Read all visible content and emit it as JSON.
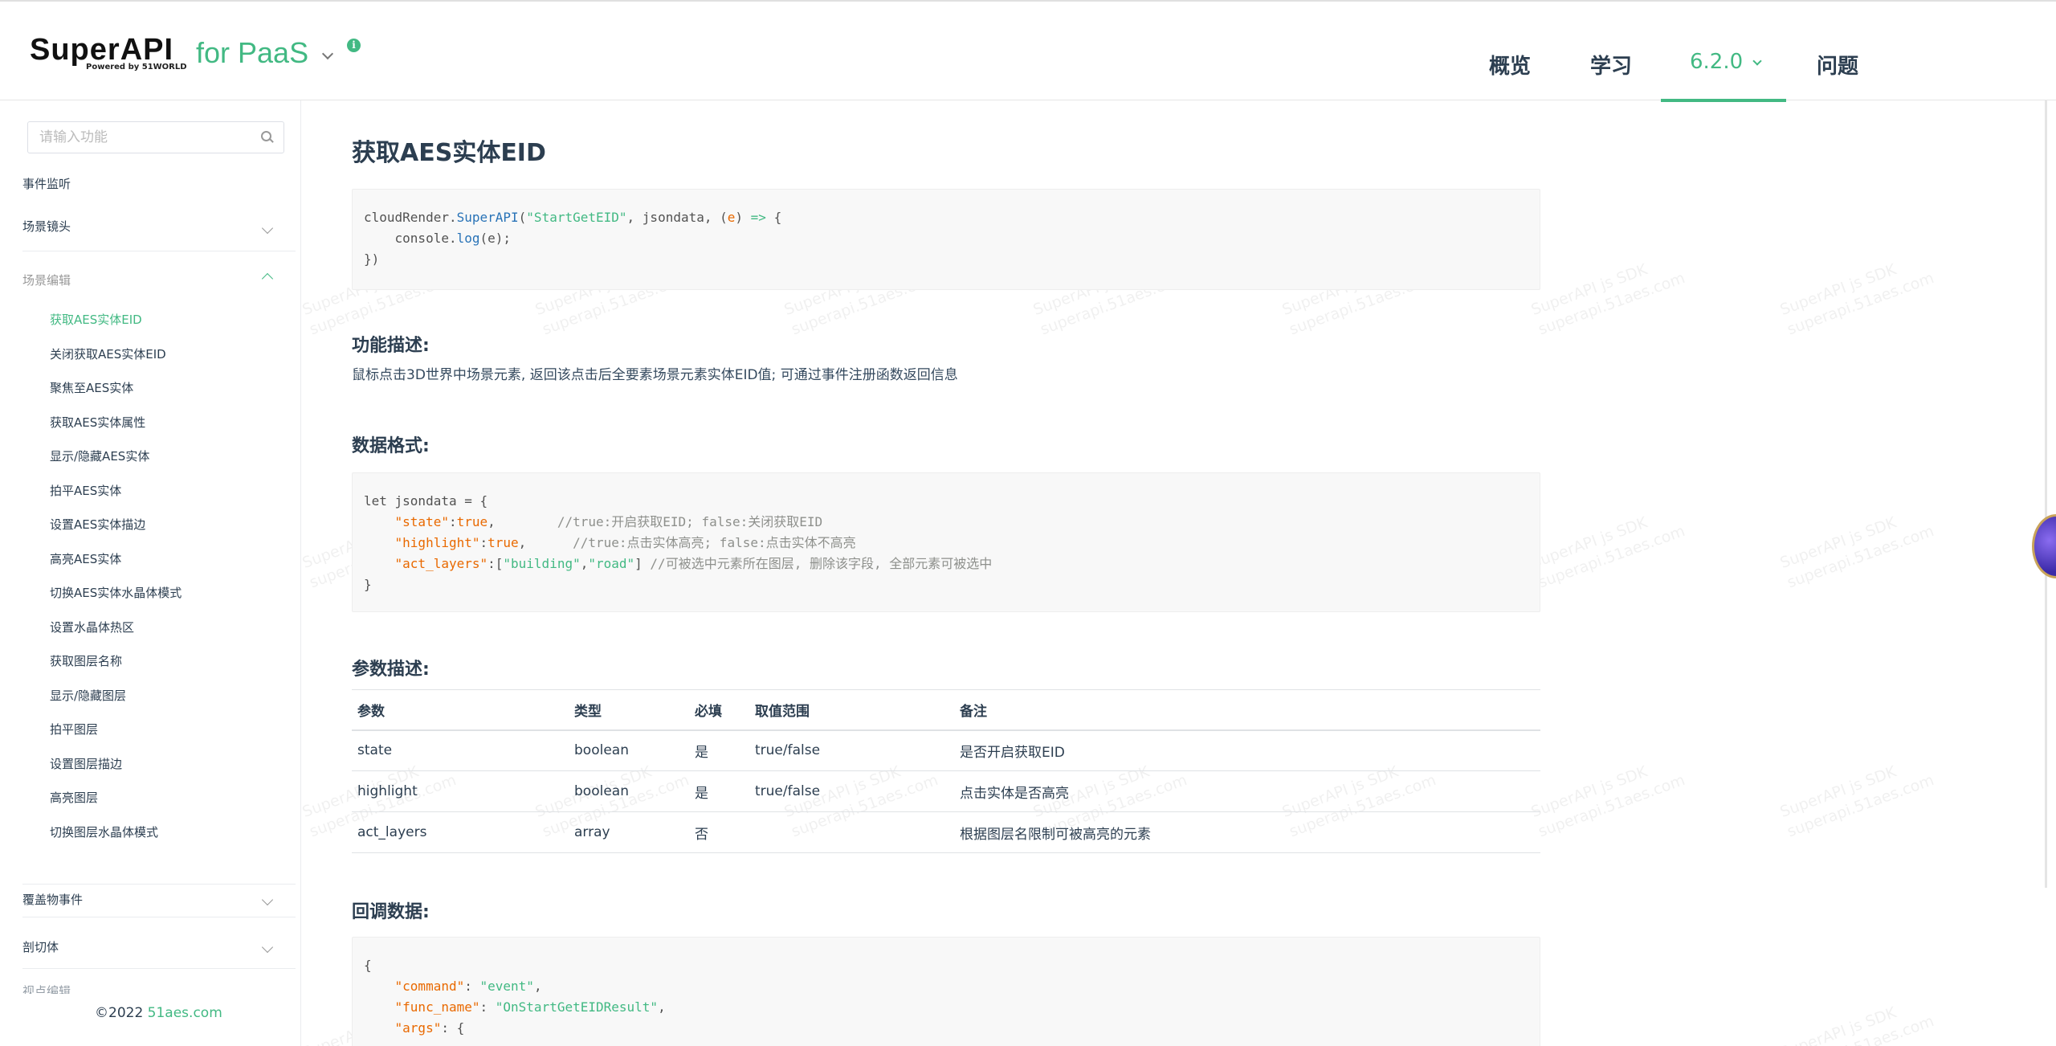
{
  "header": {
    "logo_text": "SuperAPI",
    "logo_sub": "Powered by 51WORLD",
    "product": "for PaaS",
    "info_icon": "info-icon",
    "nav": [
      {
        "label": "概览"
      },
      {
        "label": "学习"
      },
      {
        "label": "6.2.0"
      },
      {
        "label": "问题"
      }
    ]
  },
  "sidebar": {
    "search_placeholder": "请输入功能",
    "groups": {
      "event_listen": "事件监听",
      "scene_camera": "场景镜头",
      "scene_edit": "场景编辑",
      "overlay_event": "覆盖物事件",
      "section_cut": "剖切体",
      "cut_off": "视点编辑"
    },
    "items": [
      "获取AES实体EID",
      "关闭获取AES实体EID",
      "聚焦至AES实体",
      "获取AES实体属性",
      "显示/隐藏AES实体",
      "拍平AES实体",
      "设置AES实体描边",
      "高亮AES实体",
      "切换AES实体水晶体模式",
      "设置水晶体热区",
      "获取图层名称",
      "显示/隐藏图层",
      "拍平图层",
      "设置图层描边",
      "高亮图层",
      "切换图层水晶体模式"
    ],
    "footer_copyright": "©2022",
    "footer_link": "51aes.com"
  },
  "main": {
    "title": "获取AES实体EID",
    "section_desc_title": "功能描述:",
    "desc_text": "鼠标点击3D世界中场景元素, 返回该点击后全要素场景元素实体EID值; 可通过事件注册函数返回信息",
    "section_format_title": "数据格式:",
    "section_params_title": "参数描述:",
    "section_callback_title": "回调数据:",
    "code1": {
      "l1_obj": "cloudRender.",
      "l1_fn": "SuperAPI",
      "l1_str": "\"StartGetEID\"",
      "l1_rest": ", jsondata, (",
      "l1_arg": "e",
      "l1_close": ") ",
      "l1_arrow": "=>",
      "l1_brace": " {",
      "l2_obj": "    console.",
      "l2_fn": "log",
      "l2_rest": "(e);",
      "l3": "})"
    },
    "code2": {
      "l1": "let jsondata = {",
      "l2_key": "\"state\"",
      "l2_val": "true",
      "l2_com": "//true:开启获取EID; false:关闭获取EID",
      "l3_key": "\"highlight\"",
      "l3_val": "true",
      "l3_com": "//true:点击实体高亮; false:点击实体不高亮",
      "l4_key": "\"act_layers\"",
      "l4_v1": "\"building\"",
      "l4_v2": "\"road\"",
      "l4_com": "//可被选中元素所在图层, 删除该字段, 全部元素可被选中",
      "l5": "}"
    },
    "table": {
      "headers": [
        "参数",
        "类型",
        "必填",
        "取值范围",
        "备注"
      ],
      "rows": [
        [
          "state",
          "boolean",
          "是",
          "true/false",
          "是否开启获取EID"
        ],
        [
          "highlight",
          "boolean",
          "是",
          "true/false",
          "点击实体是否高亮"
        ],
        [
          "act_layers",
          "array",
          "否",
          "",
          "根据图层名限制可被高亮的元素"
        ]
      ]
    },
    "code3": {
      "l1": "{",
      "l2_key": "\"command\"",
      "l2_val": "\"event\"",
      "l3_key": "\"func_name\"",
      "l3_val": "\"OnStartGetEIDResult\"",
      "l4_key": "\"args\"",
      "l4_rest": ": {"
    },
    "watermark_l1": "SuperAPI js SDK",
    "watermark_l2": "superapi.51aes.com"
  }
}
